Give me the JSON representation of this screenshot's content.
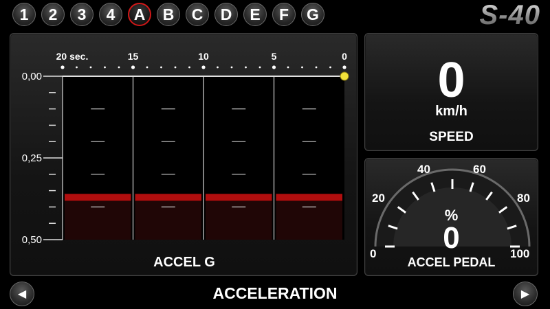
{
  "tabs": [
    "1",
    "2",
    "3",
    "4",
    "A",
    "B",
    "C",
    "D",
    "E",
    "F",
    "G"
  ],
  "active_tab": "A",
  "brand": "S-40",
  "accel_panel": {
    "title": "ACCEL G",
    "time_labels": [
      "20 sec.",
      "15",
      "10",
      "5",
      "0"
    ],
    "y_labels": [
      "0,00",
      "0,25",
      "0,50"
    ]
  },
  "speed_panel": {
    "value": "0",
    "unit": "km/h",
    "title": "SPEED"
  },
  "pedal_panel": {
    "unit": "%",
    "value": "0",
    "title": "ACCEL PEDAL",
    "scale_labels": [
      "0",
      "20",
      "40",
      "60",
      "80",
      "100"
    ],
    "level_percent": 0
  },
  "footer": {
    "title": "ACCELERATION"
  },
  "icons": {
    "prev": "arrow-left-icon",
    "next": "arrow-right-icon"
  },
  "colors": {
    "active_ring": "#d11818",
    "trace": "#c01010",
    "marker": "#f2e23a"
  },
  "chart_data": {
    "type": "area",
    "x_unit": "sec",
    "xlim": [
      20,
      0
    ],
    "ylim": [
      0,
      0.5
    ],
    "x": [
      20,
      15,
      10,
      5,
      0
    ],
    "y": [
      0.36,
      0.36,
      0.36,
      0.36,
      0.36
    ],
    "xlabel": "",
    "ylabel": "",
    "grid": true
  }
}
